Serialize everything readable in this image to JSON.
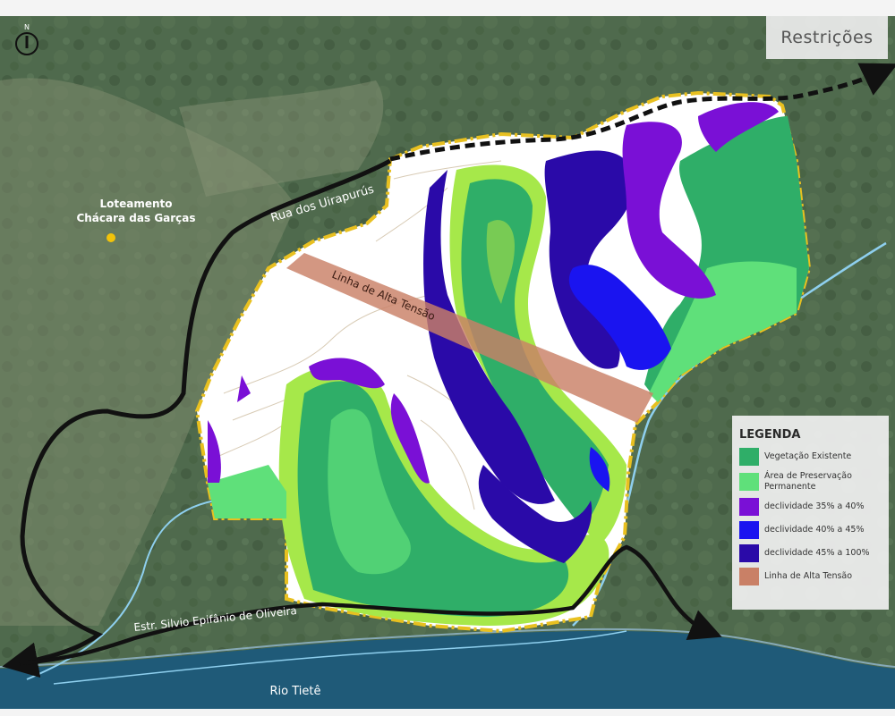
{
  "map": {
    "title": "Restrições",
    "compass_letter": "N",
    "places": {
      "loteamento_line1": "Loteamento",
      "loteamento_line2": "Chácara das Garças",
      "rua": "Rua dos Uirapurús",
      "linha_label": "Linha de Alta Tensão",
      "estrada": "Estr. Silvio Epifânio de Oliveira",
      "rio": "Rio Tietê"
    },
    "legend": {
      "title": "LEGENDA",
      "items": [
        {
          "label_lines": [
            "Vegetação Existente"
          ],
          "color": "#2fae68"
        },
        {
          "label_lines": [
            "Área de Preservação",
            "Permanente"
          ],
          "color": "#5fe07a"
        },
        {
          "label_lines": [
            "declividade 35% a 40%"
          ],
          "color": "#7a10d6"
        },
        {
          "label_lines": [
            "declividade 40% a 45%"
          ],
          "color": "#1a14f0"
        },
        {
          "label_lines": [
            "declividade 45% a 100%"
          ],
          "color": "#2a0aa8"
        },
        {
          "label_lines": [
            "Linha de Alta Tensão"
          ],
          "color": "#c98066"
        }
      ]
    },
    "colors": {
      "satellite_base": "#4f6a4d",
      "property_fill": "#ffffff",
      "boundary": "#e8c020",
      "river": "#1f5a78",
      "stream": "#8ecfee",
      "road": "#111111",
      "lime": "#a6e84a",
      "marker": "#f2c30a"
    }
  }
}
